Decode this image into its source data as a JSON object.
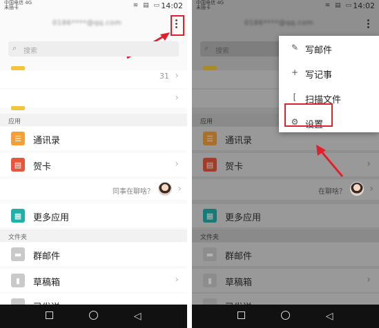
{
  "status": {
    "carrier": "中国电信 4G\n未插卡",
    "icons": "≋ ▤ ▭",
    "time": "14:02"
  },
  "header": {
    "email": "0186****@qq.com"
  },
  "search": {
    "placeholder": "搜索"
  },
  "top_items": {
    "count": "31"
  },
  "sections": {
    "apps": "应用",
    "folders": "文件夹"
  },
  "apps": [
    {
      "label": "通讯录",
      "icon": "contacts-icon"
    },
    {
      "label": "贺卡",
      "icon": "card-icon"
    }
  ],
  "notify": {
    "left_text": "同事在聊啥？",
    "right_text": "在聊啥？"
  },
  "more_apps": {
    "label": "更多应用",
    "icon": "grid-icon"
  },
  "folders": [
    {
      "label": "群邮件",
      "icon": "folder-icon"
    },
    {
      "label": "草稿箱",
      "icon": "draft-icon"
    },
    {
      "label": "已发送",
      "icon": "sent-icon"
    }
  ],
  "menu": [
    {
      "label": "写邮件",
      "icon": "edit-icon"
    },
    {
      "label": "写记事",
      "icon": "note-icon"
    },
    {
      "label": "扫描文件",
      "icon": "scan-icon"
    },
    {
      "label": "设置",
      "icon": "gear-icon"
    }
  ],
  "colors": {
    "highlight": "#e0202a",
    "orange": "#f4a038",
    "red": "#e8563a",
    "teal": "#1fb0a8"
  }
}
